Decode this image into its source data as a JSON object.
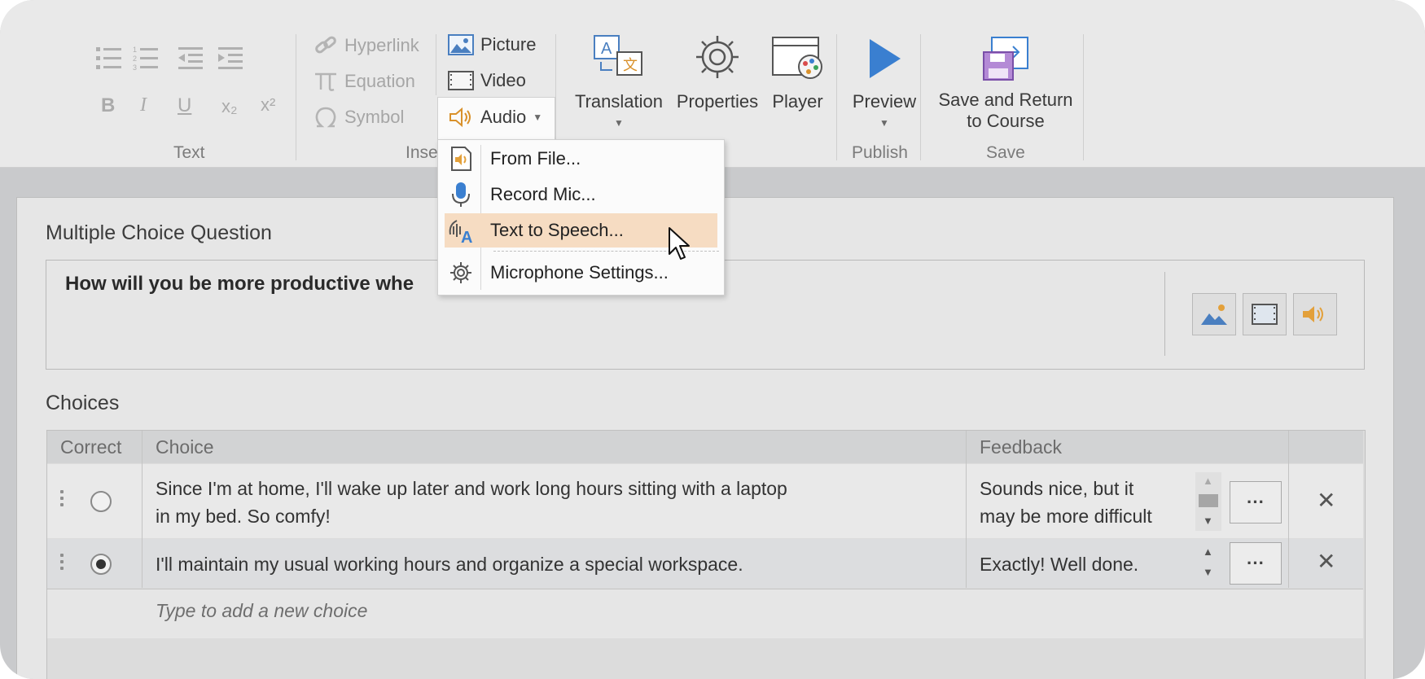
{
  "ribbon": {
    "groups": {
      "text": "Text",
      "insert": "Inse",
      "publish": "Publish",
      "save": "Save"
    },
    "insert": {
      "hyperlink": "Hyperlink",
      "equation": "Equation",
      "symbol": "Symbol",
      "picture": "Picture",
      "video": "Video",
      "audio": "Audio"
    },
    "buttons": {
      "translation": "Translation",
      "properties": "Properties",
      "player": "Player",
      "preview": "Preview",
      "save_line1": "Save and Return",
      "save_line2": "to Course"
    },
    "format": {
      "bold": "B",
      "italic": "I",
      "underline": "U",
      "subscript": "x₂",
      "superscript": "x²"
    }
  },
  "audio_menu": {
    "items": [
      {
        "label": "From File...",
        "icon": "audio-file-icon"
      },
      {
        "label": "Record Mic...",
        "icon": "microphone-icon"
      },
      {
        "label": "Text to Speech...",
        "icon": "text-to-speech-icon",
        "highlighted": true
      },
      {
        "label": "Microphone Settings...",
        "icon": "gear-icon"
      }
    ]
  },
  "question": {
    "section_title": "Multiple Choice Question",
    "text": "How will you be more productive whe"
  },
  "choices": {
    "section_title": "Choices",
    "headers": {
      "correct": "Correct",
      "choice": "Choice",
      "feedback": "Feedback"
    },
    "rows": [
      {
        "correct": false,
        "choice_line1": "Since I'm at home, I'll wake up later and work long hours sitting with a laptop",
        "choice_line2": "in my bed. So comfy!",
        "feedback_line1": "Sounds nice, but it",
        "feedback_line2": "may be more difficult",
        "more": "···",
        "remove": "✕"
      },
      {
        "correct": true,
        "choice_line1": "I'll maintain my usual working hours and organize a special workspace.",
        "feedback_line1": "Exactly! Well done.",
        "more": "···",
        "remove": "✕"
      }
    ],
    "add_placeholder": "Type to add a new choice"
  },
  "colors": {
    "ribbon_bg": "#e9e9e9",
    "menu_highlight": "#f6dcc2",
    "accent_blue": "#3a7fd0",
    "accent_orange": "#e3a03a"
  }
}
